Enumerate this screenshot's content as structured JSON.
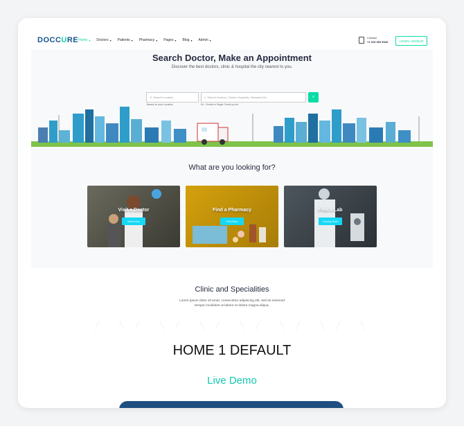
{
  "header": {
    "logo_main": "DOCC",
    "logo_accent": "U",
    "logo_end": "RE",
    "nav": [
      {
        "label": "Home",
        "active": true
      },
      {
        "label": "Doctors",
        "active": false
      },
      {
        "label": "Patients",
        "active": false
      },
      {
        "label": "Pharmacy",
        "active": false
      },
      {
        "label": "Pages",
        "active": false
      },
      {
        "label": "Blog",
        "active": false
      },
      {
        "label": "Admin",
        "active": false
      }
    ],
    "contact_label": "Contact",
    "contact_number": "+1 315 369 5943",
    "login_label": "LOGIN / SIGNUP"
  },
  "hero": {
    "title": "Search Doctor, Make an Appointment",
    "subtitle": "Discover the best doctors, clinic & hospital the city nearest to you.",
    "location_placeholder": "Search Location",
    "doctor_placeholder": "Search Doctors, Clinics, Hospitals, Diseases Etc",
    "location_hint": "Based on your Location",
    "doctor_hint": "Ex : Dental or Sugar Check up etc"
  },
  "looking": {
    "title": "What are you looking for?",
    "tiles": [
      {
        "label": "Visit a Doctor",
        "button": "Book Now"
      },
      {
        "label": "Find a Pharmacy",
        "button": "Find Now"
      },
      {
        "label": "Find a Lab",
        "button": "Coming Soon"
      }
    ]
  },
  "clinic": {
    "title": "Clinic and Specialities",
    "line1": "Lorem ipsum dolor sit amet, consectetur adipiscing elit, sed do eiusmod",
    "line2": "tempor incididunt ut labore et dolore magna aliqua."
  },
  "footer": {
    "home_label": "HOME 1 DEFAULT",
    "demo_label": "Live Demo"
  },
  "colors": {
    "accent": "#09dca4",
    "brand": "#15558d",
    "button_cyan": "#15d8f5",
    "bar": "#1f4f81"
  }
}
